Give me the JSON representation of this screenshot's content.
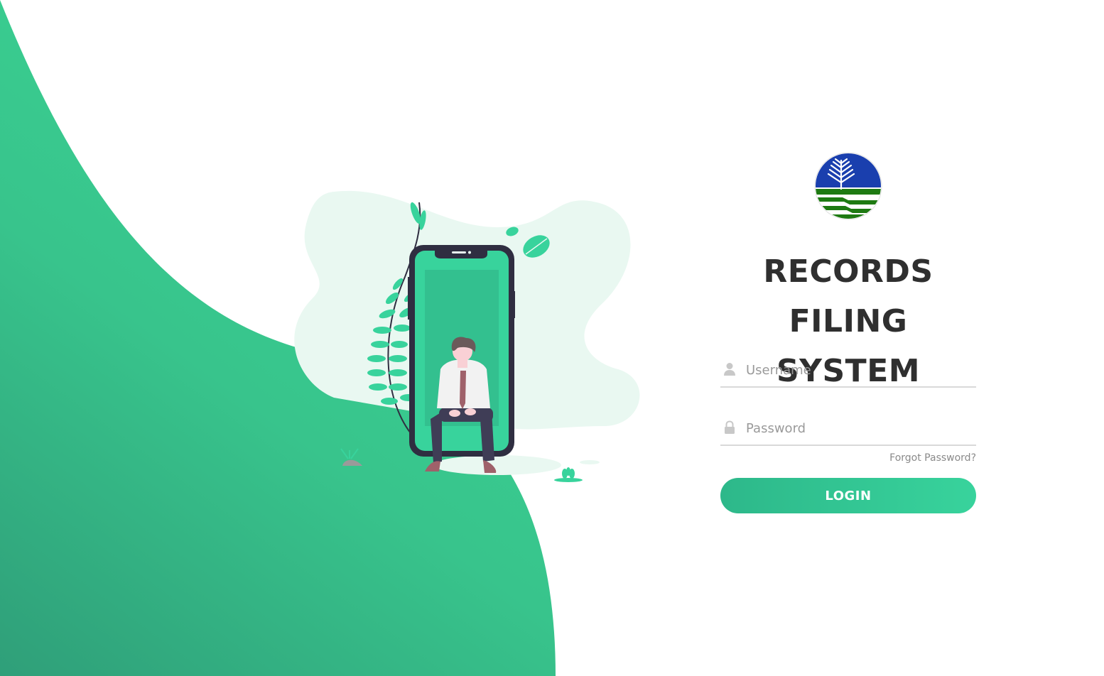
{
  "app": {
    "title_line1": "RECORDS",
    "title_line2": "FILING SYSTEM"
  },
  "form": {
    "username_placeholder": "Username",
    "username_value": "",
    "password_placeholder": "Password",
    "password_value": "",
    "forgot_label": "Forgot Password?",
    "login_label": "LOGIN"
  },
  "icons": {
    "username": "user-icon",
    "password": "lock-icon"
  },
  "colors": {
    "accent": "#38d39c",
    "accent_dark": "#2db88a",
    "title": "#2f2f2f",
    "placeholder": "#9a9a9a",
    "logo_blue": "#1a3fae",
    "logo_green": "#1e7a12"
  }
}
